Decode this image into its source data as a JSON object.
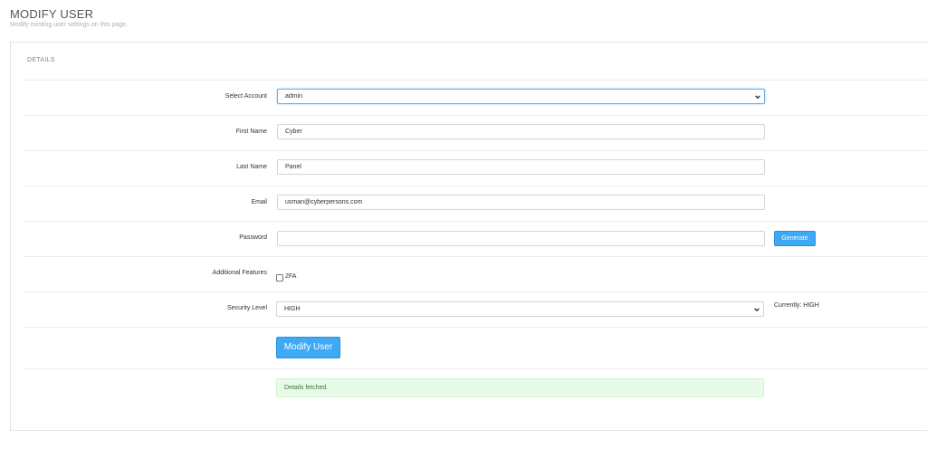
{
  "page": {
    "title": "MODIFY USER",
    "subtitle": "Modify existing user settings on this page."
  },
  "panel": {
    "heading": "DETAILS"
  },
  "form": {
    "select_account": {
      "label": "Select Account",
      "value": "admin"
    },
    "first_name": {
      "label": "First Name",
      "value": "Cyber"
    },
    "last_name": {
      "label": "Last Name",
      "value": "Panel"
    },
    "email": {
      "label": "Email",
      "value": "usman@cyberpersons.com"
    },
    "password": {
      "label": "Password",
      "value": "",
      "generate_label": "Generate"
    },
    "additional_features": {
      "label": "Additional Features",
      "twofa_label": "2FA",
      "twofa_checked": false
    },
    "security_level": {
      "label": "Security Level",
      "value": "HIGH",
      "currently": "Currently: HIGH"
    },
    "submit_label": "Modify User",
    "status_message": "Details fetched."
  },
  "colors": {
    "accent": "#3fa9f5",
    "success_bg": "#e8fbe6",
    "success_text": "#3c763d"
  },
  "icons": {
    "select_caret": "chevron-down-icon"
  }
}
